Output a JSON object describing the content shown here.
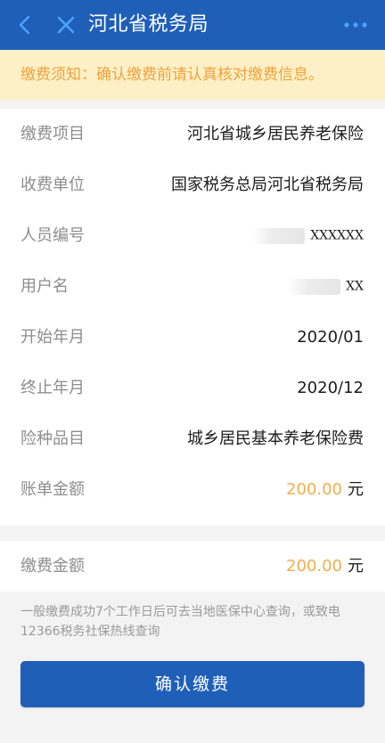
{
  "header": {
    "title": "河北省税务局",
    "back_icon": "chevron-left-icon",
    "close_icon": "close-icon",
    "more_icon": "more-dots-icon"
  },
  "notice": {
    "text": "缴费须知：确认缴费前请认真核对缴费信息。"
  },
  "details": [
    {
      "label": "缴费项目",
      "value": "河北省城乡居民养老保险"
    },
    {
      "label": "收费单位",
      "value": "国家税务总局河北省税务局"
    },
    {
      "label": "人员编号",
      "value": "XXXXXX"
    },
    {
      "label": "用户名",
      "value": "XX"
    },
    {
      "label": "开始年月",
      "value": "2020/01"
    },
    {
      "label": "终止年月",
      "value": "2020/12"
    },
    {
      "label": "险种品目",
      "value": "城乡居民基本养老保险费"
    },
    {
      "label": "账单金额",
      "amount": "200.00",
      "unit": "元"
    }
  ],
  "payment": {
    "label": "缴费金额",
    "amount": "200.00",
    "unit": "元"
  },
  "tip": "一般缴费成功7个工作日后可去当地医保中心查询，或致电12366税务社保热线查询",
  "confirm_button": "确认缴费",
  "colors": {
    "primary": "#1f5fb8",
    "notice_bg": "#fdf0c6",
    "notice_text": "#f0a23c",
    "amount": "#f4ad4b"
  }
}
